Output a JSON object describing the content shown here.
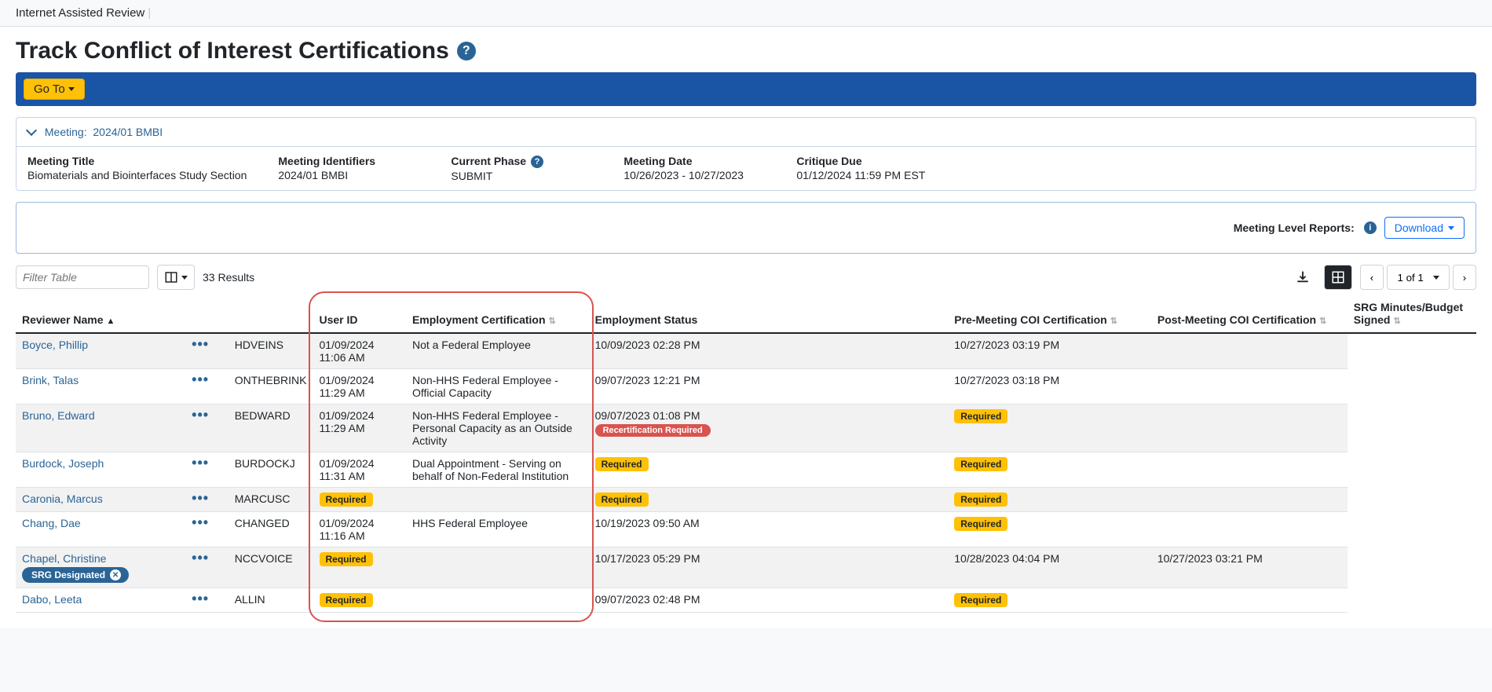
{
  "topbar": {
    "title": "Internet Assisted Review"
  },
  "page": {
    "title": "Track Conflict of Interest Certifications"
  },
  "bluebar": {
    "goto_label": "Go To"
  },
  "panel": {
    "header_prefix": "Meeting:",
    "header_value": "2024/01 BMBI",
    "meta": [
      {
        "label": "Meeting Title",
        "value": "Biomaterials and Biointerfaces Study Section",
        "help": false
      },
      {
        "label": "Meeting Identifiers",
        "value": "2024/01 BMBI",
        "help": false
      },
      {
        "label": "Current Phase",
        "value": "SUBMIT",
        "help": true
      },
      {
        "label": "Meeting Date",
        "value": "10/26/2023 - 10/27/2023",
        "help": false
      },
      {
        "label": "Critique Due",
        "value": "01/12/2024 11:59 PM EST",
        "help": false
      }
    ]
  },
  "reportbar": {
    "label": "Meeting Level Reports:",
    "download_label": "Download"
  },
  "toolbar": {
    "filter_placeholder": "Filter Table",
    "results_text": "33 Results",
    "page_text": "1 of 1"
  },
  "columns": [
    "Reviewer Name",
    "User ID",
    "Employment Certification",
    "Employment Status",
    "Pre-Meeting COI Certification",
    "Post-Meeting COI Certification",
    "SRG Minutes/Budget Signed"
  ],
  "rows": [
    {
      "name": "Boyce, Phillip",
      "user": "HDVEINS",
      "empcert": "01/09/2024 11:06 AM",
      "empstatus": "Not a Federal Employee",
      "pre": "10/09/2023 02:28 PM",
      "post": "10/27/2023 03:19 PM",
      "srg": ""
    },
    {
      "name": "Brink, Talas",
      "user": "ONTHEBRINK",
      "empcert": "01/09/2024 11:29 AM",
      "empstatus": "Non-HHS Federal Employee - Official Capacity",
      "pre": "09/07/2023 12:21 PM",
      "post": "10/27/2023 03:18 PM",
      "srg": ""
    },
    {
      "name": "Bruno, Edward",
      "user": "BEDWARD",
      "empcert": "01/09/2024 11:29 AM",
      "empstatus": "Non-HHS Federal Employee - Personal Capacity as an Outside Activity",
      "pre": "09/07/2023 01:08 PM",
      "pre_recert": true,
      "post_required": true,
      "srg": ""
    },
    {
      "name": "Burdock, Joseph",
      "user": "BURDOCKJ",
      "empcert": "01/09/2024 11:31 AM",
      "empstatus": "Dual Appointment - Serving on behalf of Non-Federal Institution",
      "pre_required": true,
      "post_required": true,
      "srg": ""
    },
    {
      "name": "Caronia, Marcus",
      "user": "MARCUSC",
      "empcert_required": true,
      "empstatus": "",
      "pre_required": true,
      "post_required": true,
      "srg": ""
    },
    {
      "name": "Chang, Dae",
      "user": "CHANGED",
      "empcert": "01/09/2024 11:16 AM",
      "empstatus": "HHS Federal Employee",
      "pre": "10/19/2023 09:50 AM",
      "post_required": true,
      "srg": ""
    },
    {
      "name": "Chapel, Christine",
      "srg_designated": true,
      "user": "NCCVOICE",
      "empcert_required": true,
      "empstatus": "",
      "pre": "10/17/2023 05:29 PM",
      "post": "10/28/2023 04:04 PM",
      "srg": "10/27/2023 03:21 PM"
    },
    {
      "name": "Dabo, Leeta",
      "user": "ALLIN",
      "empcert_required": true,
      "empstatus": "",
      "pre": "09/07/2023 02:48 PM",
      "post_required": true,
      "srg": ""
    }
  ],
  "badges": {
    "required": "Required",
    "recert": "Recertification Required",
    "srg_designated": "SRG Designated"
  }
}
